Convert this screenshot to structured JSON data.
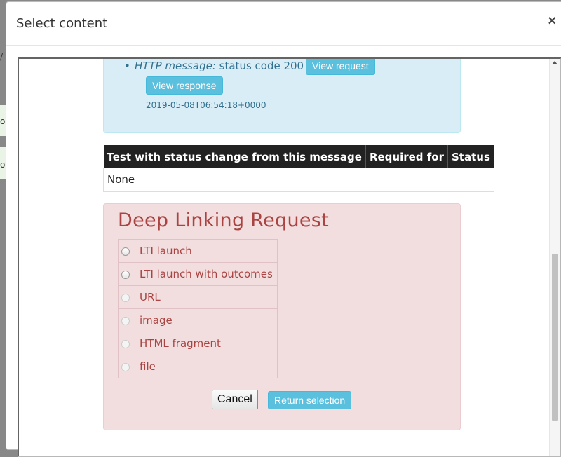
{
  "modal": {
    "title": "Select content",
    "close_label": "×"
  },
  "message": {
    "label": "HTTP message:",
    "text": "status code 200",
    "view_request": "View request",
    "view_response": "View response",
    "timestamp": "2019-05-08T06:54:18+0000"
  },
  "status_table": {
    "headers": [
      "Test with status change from this message",
      "Required for",
      "Status"
    ],
    "empty_value": "None"
  },
  "deep_linking": {
    "title": "Deep Linking Request",
    "options": [
      "LTI launch",
      "LTI launch with outcomes",
      "URL",
      "image",
      "HTML fragment",
      "file"
    ],
    "cancel_label": "Cancel",
    "return_label": "Return selection"
  },
  "background": {
    "glyphs": [
      "/",
      "o",
      "o"
    ]
  },
  "colors": {
    "info_bg": "#d9edf7",
    "danger_bg": "#f2dede",
    "danger_text": "#a94442",
    "btn_info": "#5bc0de"
  }
}
